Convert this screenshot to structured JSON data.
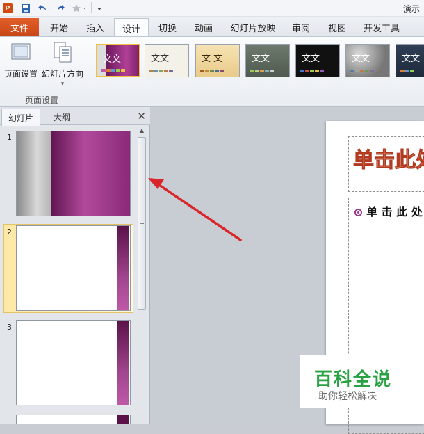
{
  "qat": {
    "app_icon_letter": "P",
    "title_text": "演示"
  },
  "tabs": {
    "file": "文件",
    "items": [
      "开始",
      "插入",
      "设计",
      "切换",
      "动画",
      "幻灯片放映",
      "审阅",
      "视图",
      "开发工具"
    ],
    "active": "设计"
  },
  "ribbon": {
    "page_setup_label": "页面设置",
    "slide_orientation_label": "幻灯片方向",
    "group_label": "页面设置",
    "theme_text": "文文",
    "theme_text_small": "文 文"
  },
  "panel": {
    "tab_slides": "幻灯片",
    "tab_outline": "大纲",
    "close_glyph": "✕",
    "slide_numbers": [
      "1",
      "2",
      "3"
    ]
  },
  "editor": {
    "title_placeholder": "单击此处",
    "body_placeholder": "单 击 此 处"
  },
  "watermark": {
    "title": "百科全说",
    "subtitle": "助你轻松解决"
  },
  "colors": {
    "accent_file": "#d2511c",
    "arrow": "#d8262a",
    "theme_purple": "#8e2a73"
  }
}
